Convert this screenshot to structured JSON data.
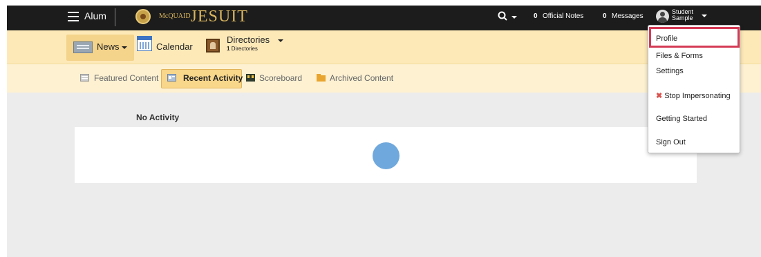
{
  "header": {
    "app_label": "Alum",
    "logo_text": "JESUIT",
    "logo_small": "McQUAID",
    "official_notes_count": "0",
    "official_notes_label": "Official Notes",
    "messages_count": "0",
    "messages_label": "Messages",
    "user_first": "Student",
    "user_last": "Sample"
  },
  "nav": {
    "news": "News",
    "calendar": "Calendar",
    "directories": "Directories",
    "directories_count": "1",
    "directories_sub": "Directories"
  },
  "subnav": {
    "featured": "Featured Content",
    "recent": "Recent Activity",
    "scoreboard": "Scoreboard",
    "archived": "Archived Content"
  },
  "main": {
    "empty_label": "No Activity"
  },
  "user_menu": {
    "items": [
      "Profile",
      "Files & Forms",
      "Settings",
      "Stop Impersonating",
      "Getting Started",
      "Sign Out"
    ]
  },
  "colors": {
    "topbar": "#1c1c1c",
    "nav_bg": "#fde9b8",
    "subnav_bg": "#fdf1d2",
    "highlight": "#d43a55",
    "spinner": "#6fa8dc"
  }
}
